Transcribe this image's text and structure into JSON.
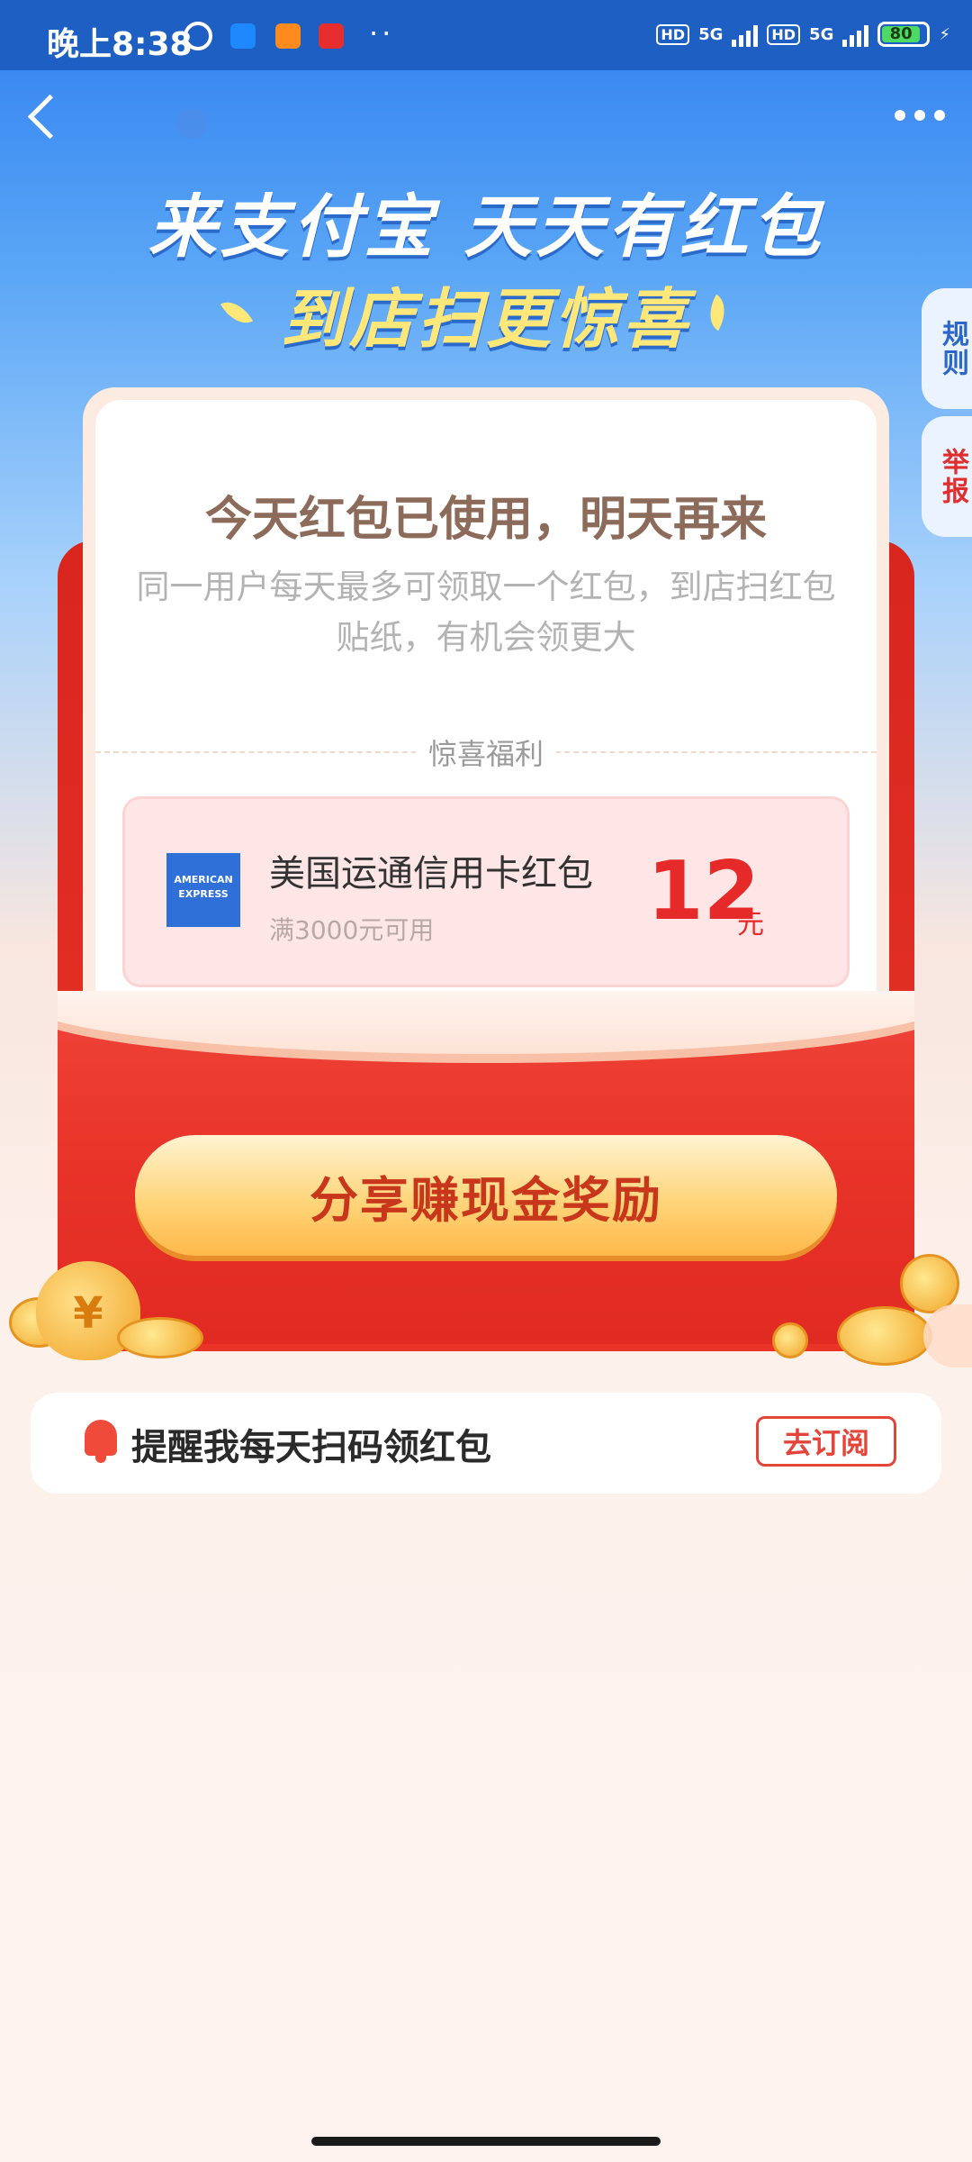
{
  "status_bar": {
    "time": "晚上8:38",
    "network_1": "5G",
    "network_2": "5G",
    "hd_1": "HD",
    "hd_2": "HD",
    "battery": "80"
  },
  "header": {
    "headline": "来支付宝 天天有红包",
    "subheadline": "到店扫更惊喜"
  },
  "side_tabs": {
    "rules": "规则",
    "report": "举报"
  },
  "card": {
    "status_title": "今天红包已使用，明天再来",
    "description": "同一用户每天最多可领取一个红包，到店扫红包贴纸，有机会领更大",
    "section_label": "惊喜福利",
    "coupon": {
      "logo_text": "AMERICAN EXPRESS",
      "title": "美国运通信用卡红包",
      "condition": "满3000元可用",
      "amount": "12",
      "unit": "元"
    }
  },
  "share_button": "分享赚现金奖励",
  "subscribe": {
    "text": "提醒我每天扫码领红包",
    "button": "去订阅"
  },
  "colors": {
    "brand_blue": "#2f7ff0",
    "envelope_red": "#e9342a",
    "amount_red": "#e62a2a",
    "button_gold": "#ffd57a"
  }
}
